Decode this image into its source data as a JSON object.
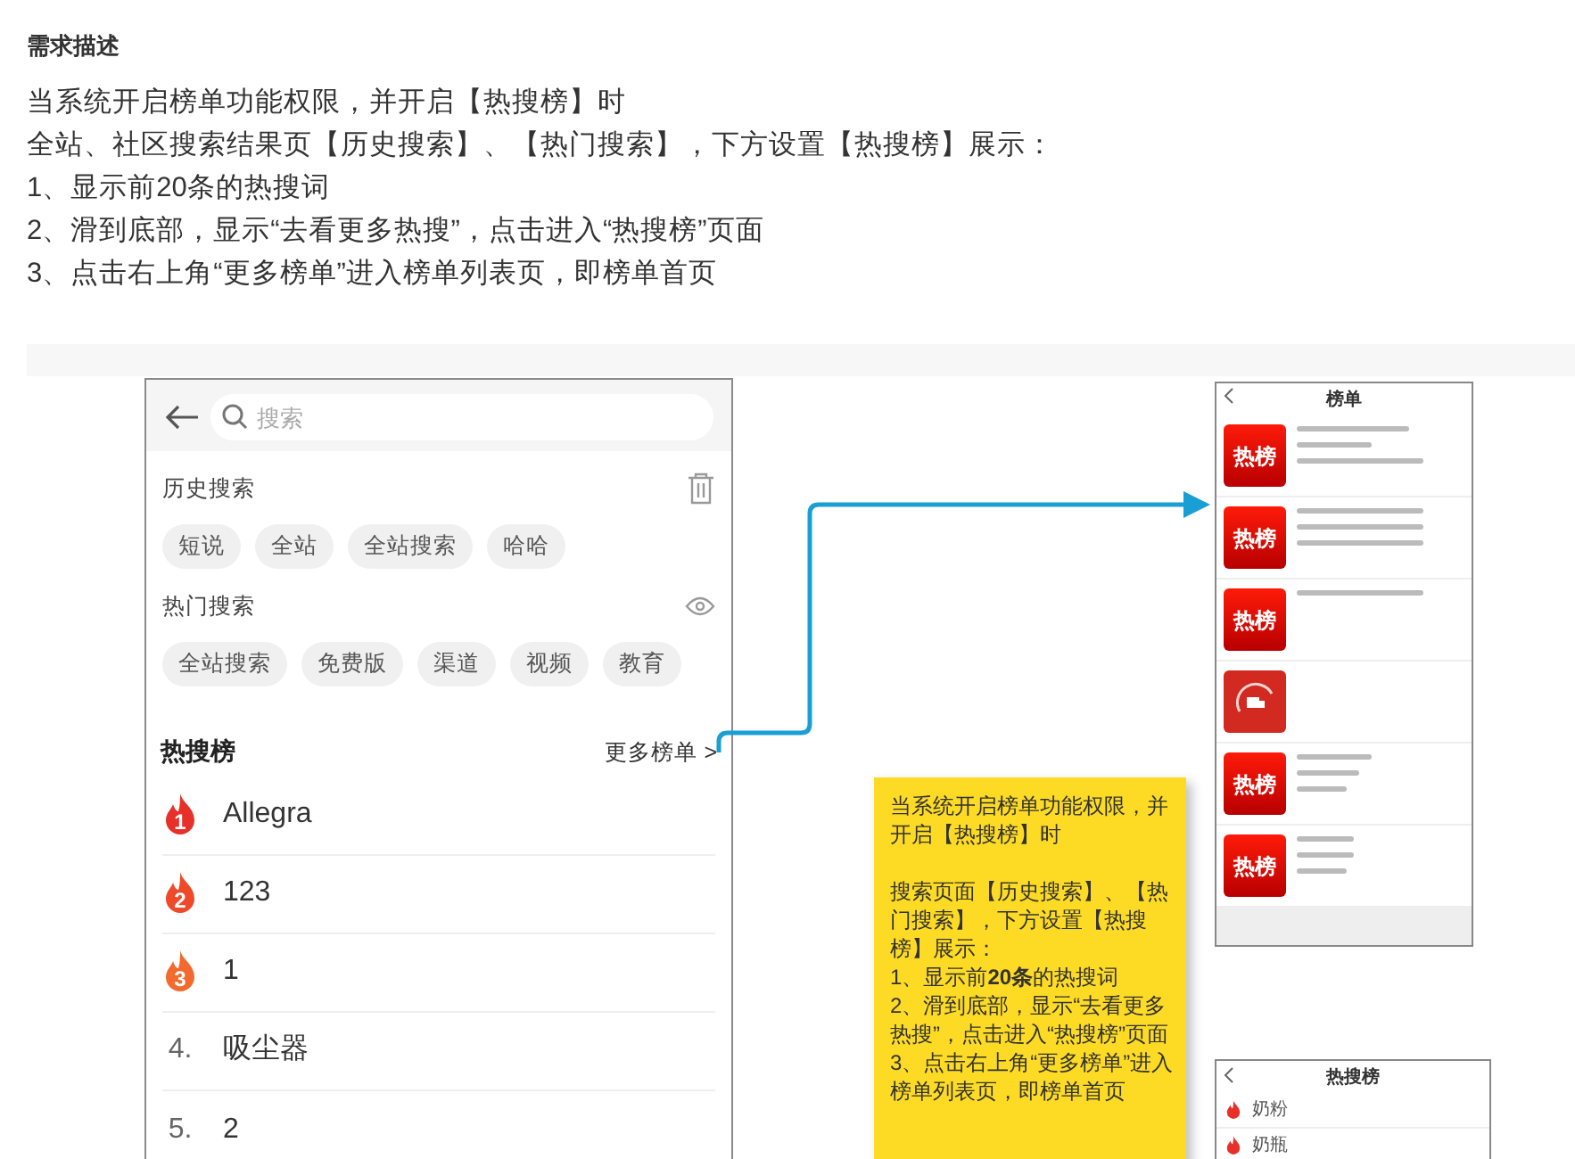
{
  "requirement": {
    "heading": "需求描述",
    "lines": [
      "当系统开启榜单功能权限，并开启【热搜榜】时",
      "全站、社区搜索结果页【历史搜索】、【热门搜索】，下方设置【热搜榜】展示：",
      "1、显示前20条的热搜词",
      "2、滑到底部，显示“去看更多热搜”，点击进入“热搜榜”页面",
      "3、点击右上角“更多榜单”进入榜单列表页，即榜单首页"
    ]
  },
  "search_page": {
    "search": {
      "placeholder": "搜索"
    },
    "history": {
      "title": "历史搜索",
      "chips": [
        "短说",
        "全站",
        "全站搜索",
        "哈哈"
      ]
    },
    "hot_search": {
      "title": "热门搜索",
      "chips": [
        "全站搜索",
        "免费版",
        "渠道",
        "视频",
        "教育"
      ]
    },
    "hot_list": {
      "title": "热搜榜",
      "more": "更多榜单 >",
      "items": [
        {
          "kind": "flame",
          "rank": "1",
          "term": "Allegra",
          "color": "#e8302a"
        },
        {
          "kind": "flame",
          "rank": "2",
          "term": "123",
          "color": "#ee4a2a"
        },
        {
          "kind": "flame",
          "rank": "3",
          "term": "1",
          "color": "#f26a2e"
        },
        {
          "kind": "number",
          "rank": "4.",
          "term": "吸尘器"
        },
        {
          "kind": "number",
          "rank": "5.",
          "term": "2"
        }
      ]
    }
  },
  "note": {
    "paragraphs": [
      [
        "当系统开启榜单功能权限，并开启【热搜榜】时"
      ],
      [
        "搜索页面【历史搜索】、【热门搜索】，下方设置【热搜榜】展示：",
        "1、显示前**20条**的热搜词",
        "2、滑到底部，显示“去看更多热搜”，点击进入“热搜榜”页面",
        "3、点击右上角“更多榜单”进入榜单列表页，即榜单首页"
      ]
    ]
  },
  "rank_list_page": {
    "title": "榜单",
    "rows": [
      {
        "kind": "hot",
        "tile": "热榜"
      },
      {
        "kind": "hot",
        "tile": "热榜"
      },
      {
        "kind": "hot",
        "tile": "热榜"
      },
      {
        "kind": "truck"
      },
      {
        "kind": "hot",
        "tile": "热榜"
      },
      {
        "kind": "hot",
        "tile": "热榜"
      }
    ]
  },
  "hot_rank_page": {
    "title": "热搜榜",
    "items": [
      "奶粉",
      "奶瓶"
    ]
  }
}
